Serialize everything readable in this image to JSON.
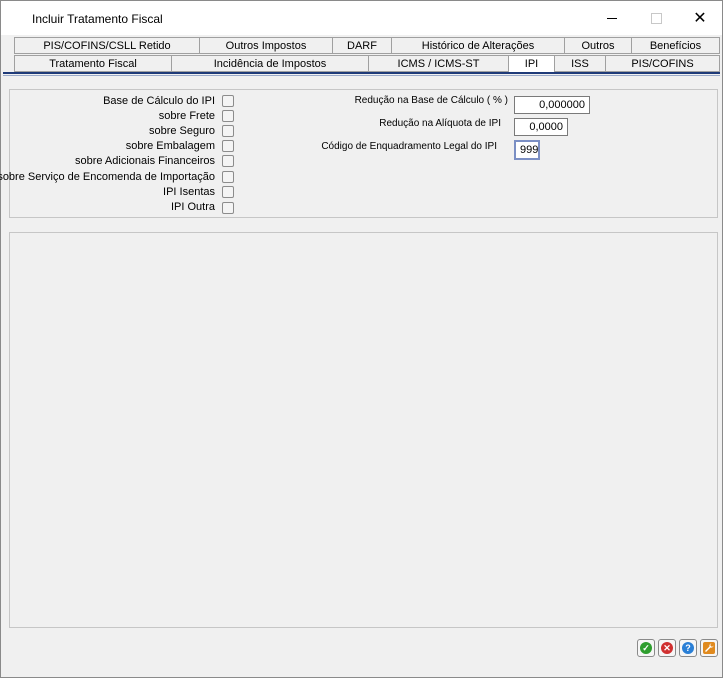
{
  "window": {
    "title": "Incluir Tratamento Fiscal",
    "minimize": "–",
    "maximize": "□",
    "close": "✕"
  },
  "tabs_row1": [
    "PIS/COFINS/CSLL Retido",
    "Outros Impostos",
    "DARF",
    "Histórico de Alterações",
    "Outros",
    "Benefícios"
  ],
  "tabs_row2": [
    "Tratamento Fiscal",
    "Incidência de Impostos",
    "ICMS / ICMS-ST",
    "IPI",
    "ISS",
    "PIS/COFINS"
  ],
  "active_tab": "IPI",
  "checkboxes": [
    {
      "label": "Base de Cálculo do IPI",
      "checked": false
    },
    {
      "label": "sobre Frete",
      "checked": false
    },
    {
      "label": "sobre Seguro",
      "checked": false
    },
    {
      "label": "sobre Embalagem",
      "checked": false
    },
    {
      "label": "sobre Adicionais Financeiros",
      "checked": false
    },
    {
      "label": "sobre Serviço de Encomenda de Importação",
      "checked": false
    },
    {
      "label": "IPI Isentas",
      "checked": false
    },
    {
      "label": "IPI Outra",
      "checked": false
    }
  ],
  "fields": {
    "reducao_base": {
      "label": "Redução na Base de Cálculo ( % )",
      "value": "0,000000"
    },
    "reducao_aliquota": {
      "label": "Redução na Alíquota de IPI",
      "value": "0,0000"
    },
    "codigo_enquadramento": {
      "label": "Código de Enquadramento Legal do IPI",
      "value": "999"
    }
  },
  "footer_buttons": [
    {
      "name": "confirm",
      "icon": "check-icon",
      "color": "#2e9e2e",
      "glyph": "✓"
    },
    {
      "name": "cancel",
      "icon": "x-circle-icon",
      "color": "#d03030",
      "glyph": "✕"
    },
    {
      "name": "help",
      "icon": "question-icon",
      "color": "#2a7fd6",
      "glyph": "?"
    },
    {
      "name": "tools",
      "icon": "wrench-icon",
      "color": "#e08a1e",
      "glyph": "🔧"
    }
  ]
}
